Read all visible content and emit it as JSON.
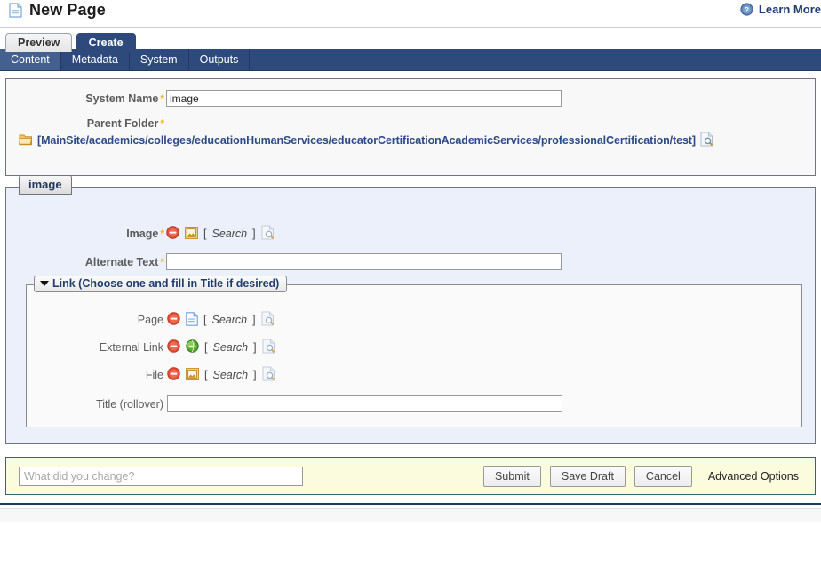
{
  "header": {
    "title": "New Page",
    "doc_icon": "page-document-icon",
    "learn_more": {
      "label": "Learn More",
      "icon": "help-question-icon"
    }
  },
  "primary_tabs": [
    {
      "label": "Preview",
      "active": false
    },
    {
      "label": "Create",
      "active": true
    }
  ],
  "secondary_tabs": [
    {
      "label": "Content",
      "active": true
    },
    {
      "label": "Metadata",
      "active": false
    },
    {
      "label": "System",
      "active": false
    },
    {
      "label": "Outputs",
      "active": false
    }
  ],
  "top_panel": {
    "system_name": {
      "label": "System Name",
      "required_marker": "*",
      "value": "image",
      "placeholder": ""
    },
    "parent_folder": {
      "label": "Parent Folder",
      "required_marker": "*",
      "folder_icon": "folder-icon",
      "path": "[MainSite/academics/colleges/educationHumanServices/educatorCertificationAcademicServices/professionalCertification/test]",
      "browse_icon": "page-search-icon"
    }
  },
  "image_panel": {
    "legend": "image",
    "image_field": {
      "label": "Image",
      "required_marker": "*",
      "delete_icon": "delete-circle-icon",
      "type_icon": "image-file-icon",
      "search_open": "[",
      "search_label": "Search",
      "search_close": "]",
      "browse_icon": "page-search-icon"
    },
    "alternate_text": {
      "label": "Alternate Text",
      "required_marker": "*",
      "value": "",
      "placeholder": ""
    },
    "link_fieldset": {
      "legend": "Link (Choose one and fill in Title if desired)",
      "caret_icon": "chevron-down-icon",
      "rows": [
        {
          "label": "Page",
          "delete_icon": "delete-circle-icon",
          "type_icon": "page-file-icon",
          "search_open": "[",
          "search_label": "Search",
          "search_close": "]",
          "browse_icon": "page-search-icon"
        },
        {
          "label": "External Link",
          "delete_icon": "delete-circle-icon",
          "type_icon": "globe-icon",
          "search_open": "[",
          "search_label": "Search",
          "search_close": "]",
          "browse_icon": "page-search-icon"
        },
        {
          "label": "File",
          "delete_icon": "delete-circle-icon",
          "type_icon": "image-file-icon",
          "search_open": "[",
          "search_label": "Search",
          "search_close": "]",
          "browse_icon": "page-search-icon"
        }
      ],
      "title_field": {
        "label": "Title (rollover)",
        "value": "",
        "placeholder": ""
      }
    }
  },
  "bottom_bar": {
    "comment": {
      "value": "",
      "placeholder": "What did you change?"
    },
    "submit_label": "Submit",
    "save_draft_label": "Save Draft",
    "cancel_label": "Cancel",
    "advanced_options_label": "Advanced Options"
  },
  "colors": {
    "nav_blue": "#2e4a7d",
    "nav_blue_active": "#43608f",
    "panel_blue": "#ecf0fa",
    "panel_gray": "#f8f8f8",
    "bottom_yellow": "#fbfbdd",
    "link_blue": "#2c4a86",
    "required_star": "#f0b429"
  }
}
